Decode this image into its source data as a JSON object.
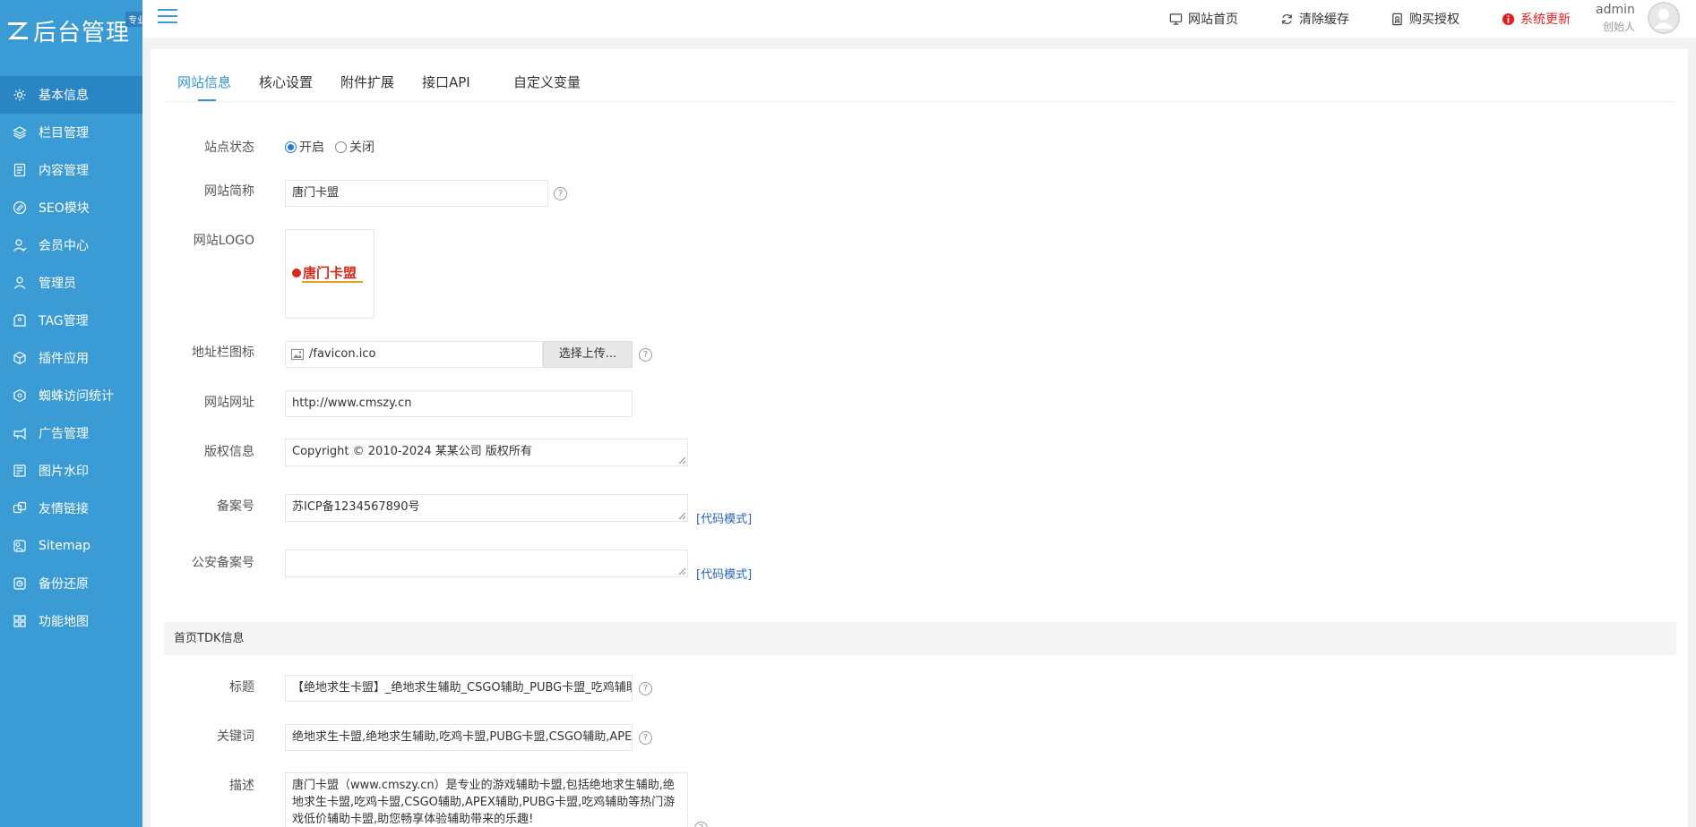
{
  "brand": {
    "title": "后台管理",
    "badge": "专业版"
  },
  "sidebar": {
    "items": [
      {
        "label": "基本信息",
        "icon": "gear-icon",
        "active": true
      },
      {
        "label": "栏目管理",
        "icon": "layers-icon"
      },
      {
        "label": "内容管理",
        "icon": "document-icon"
      },
      {
        "label": "SEO模块",
        "icon": "seo-icon"
      },
      {
        "label": "会员中心",
        "icon": "member-icon"
      },
      {
        "label": "管理员",
        "icon": "user-icon"
      },
      {
        "label": "TAG管理",
        "icon": "tag-icon"
      },
      {
        "label": "插件应用",
        "icon": "plugin-icon"
      },
      {
        "label": "蜘蛛访问统计",
        "icon": "spider-icon"
      },
      {
        "label": "广告管理",
        "icon": "ad-icon"
      },
      {
        "label": "图片水印",
        "icon": "watermark-icon"
      },
      {
        "label": "友情链接",
        "icon": "link-icon"
      },
      {
        "label": "Sitemap",
        "icon": "sitemap-icon"
      },
      {
        "label": "备份还原",
        "icon": "backup-icon"
      },
      {
        "label": "功能地图",
        "icon": "grid-icon"
      }
    ]
  },
  "topbar": {
    "links": {
      "home": "网站首页",
      "clear_cache": "清除缓存",
      "buy_license": "购买授权",
      "update": "系统更新"
    },
    "user": {
      "name": "admin",
      "role": "创始人"
    }
  },
  "tabs": [
    "网站信息",
    "核心设置",
    "附件扩展",
    "接口API",
    "自定义变量"
  ],
  "form": {
    "site_status": {
      "label": "站点状态",
      "on": "开启",
      "off": "关闭",
      "selected": "开启"
    },
    "site_name": {
      "label": "网站简称",
      "value": "唐门卡盟"
    },
    "site_logo": {
      "label": "网站LOGO",
      "logo_text": "唐门卡盟"
    },
    "favicon": {
      "label": "地址栏图标",
      "value": "/favicon.ico",
      "button": "选择上传..."
    },
    "site_url": {
      "label": "网站网址",
      "value": "http://www.cmszy.cn"
    },
    "copyright": {
      "label": "版权信息",
      "value": "Copyright © 2010-2024 某某公司 版权所有"
    },
    "icp": {
      "label": "备案号",
      "value": "苏ICP备1234567890号",
      "code_mode": "[代码模式]"
    },
    "police": {
      "label": "公安备案号",
      "value": "",
      "code_mode": "[代码模式]"
    }
  },
  "tdk": {
    "section_title": "首页TDK信息",
    "title": {
      "label": "标题",
      "value": "【绝地求生卡盟】_绝地求生辅助_CSGO辅助_PUBG卡盟_吃鸡辅助"
    },
    "keywords": {
      "label": "关键词",
      "value": "绝地求生卡盟,绝地求生辅助,吃鸡卡盟,PUBG卡盟,CSGO辅助,APEX辅助"
    },
    "description": {
      "label": "描述",
      "value": "唐门卡盟（www.cmszy.cn）是专业的游戏辅助卡盟,包括绝地求生辅助,绝地求生卡盟,吃鸡卡盟,CSGO辅助,APEX辅助,PUBG卡盟,吃鸡辅助等热门游戏低价辅助卡盟,助您畅享体验辅助带来的乐趣!"
    }
  },
  "colors": {
    "sidebar": "#3a9bd5",
    "sidebar_active": "#2a85c4",
    "accent": "#2f95d8",
    "update": "#e02020",
    "code_link": "#2a62b8"
  }
}
